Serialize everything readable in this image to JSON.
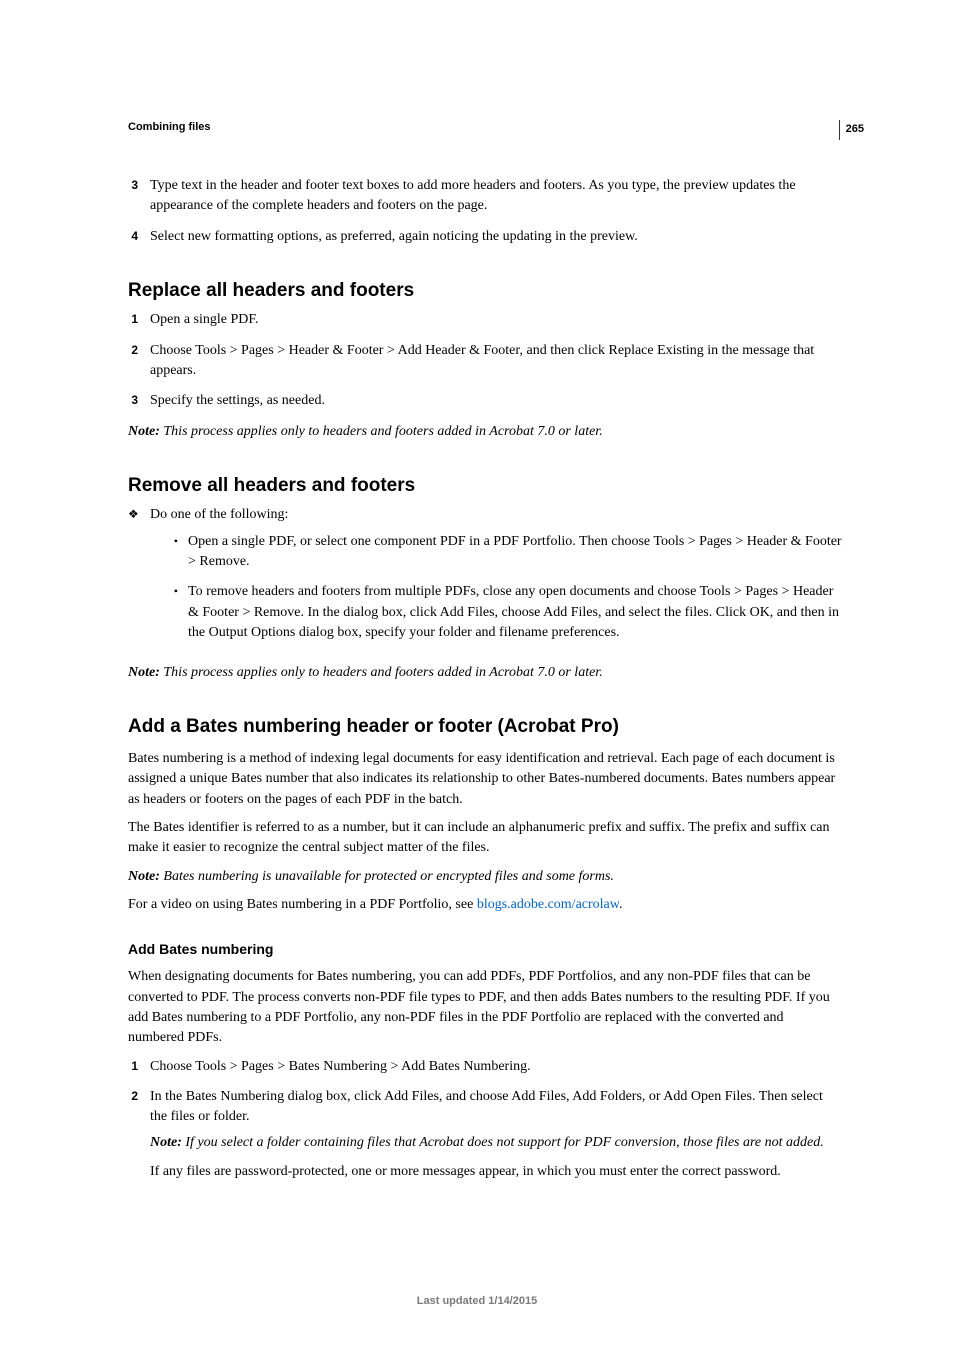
{
  "page": {
    "number": "265",
    "section": "Combining files",
    "footer": "Last updated 1/14/2015"
  },
  "intro_steps": [
    {
      "n": "3",
      "text": "Type text in the header and footer text boxes to add more headers and footers. As you type, the preview updates the appearance of the complete headers and footers on the page."
    },
    {
      "n": "4",
      "text": "Select new formatting options, as preferred, again noticing the updating in the preview."
    }
  ],
  "replace": {
    "heading": "Replace all headers and footers",
    "steps": [
      {
        "n": "1",
        "text": "Open a single PDF."
      },
      {
        "n": "2",
        "text": "Choose Tools > Pages > Header & Footer > Add Header & Footer, and then click Replace Existing in the message that appears."
      },
      {
        "n": "3",
        "text": "Specify the settings, as needed."
      }
    ],
    "note_label": "Note: ",
    "note_body": "This process applies only to headers and footers added in Acrobat 7.0 or later."
  },
  "remove": {
    "heading": "Remove all headers and footers",
    "lead": "Do one of the following:",
    "items": [
      "Open a single PDF, or select one component PDF in a PDF Portfolio. Then choose Tools > Pages > Header & Footer > Remove.",
      "To remove headers and footers from multiple PDFs, close any open documents and choose Tools > Pages > Header & Footer > Remove. In the dialog box, click Add Files, choose Add Files, and select the files. Click OK, and then in the Output Options dialog box, specify your folder and filename preferences."
    ],
    "note_label": "Note: ",
    "note_body": "This process applies only to headers and footers added in Acrobat 7.0 or later."
  },
  "bates": {
    "heading": "Add a Bates numbering header or footer (Acrobat Pro)",
    "p1": "Bates numbering is a method of indexing legal documents for easy identification and retrieval. Each page of each document is assigned a unique Bates number that also indicates its relationship to other Bates-numbered documents. Bates numbers appear as headers or footers on the pages of each PDF in the batch.",
    "p2": "The Bates identifier is referred to as a number, but it can include an alphanumeric prefix and suffix. The prefix and suffix can make it easier to recognize the central subject matter of the files.",
    "note_label": "Note: ",
    "note_body": "Bates numbering is unavailable for protected or encrypted files and some forms.",
    "video_prefix": "For a video on using Bates numbering in a PDF Portfolio, see ",
    "video_link": "blogs.adobe.com/acrolaw",
    "video_suffix": ".",
    "sub": {
      "heading": "Add Bates numbering",
      "intro": "When designating documents for Bates numbering, you can add PDFs, PDF Portfolios, and any non-PDF files that can be converted to PDF. The process converts non-PDF file types to PDF, and then adds Bates numbers to the resulting PDF. If you add Bates numbering to a PDF Portfolio, any non-PDF files in the PDF Portfolio are replaced with the converted and numbered PDFs.",
      "steps": [
        {
          "n": "1",
          "text": "Choose Tools > Pages > Bates Numbering > Add Bates Numbering."
        },
        {
          "n": "2",
          "text": "In the Bates Numbering dialog box, click Add Files, and choose Add Files, Add Folders, or Add Open Files. Then select the files or folder."
        }
      ],
      "step2_note_label": "Note: ",
      "step2_note_body": "If you select a folder containing files that Acrobat does not support for PDF conversion, those files are not added.",
      "step2_para": "If any files are password-protected, one or more messages appear, in which you must enter the correct password."
    }
  }
}
